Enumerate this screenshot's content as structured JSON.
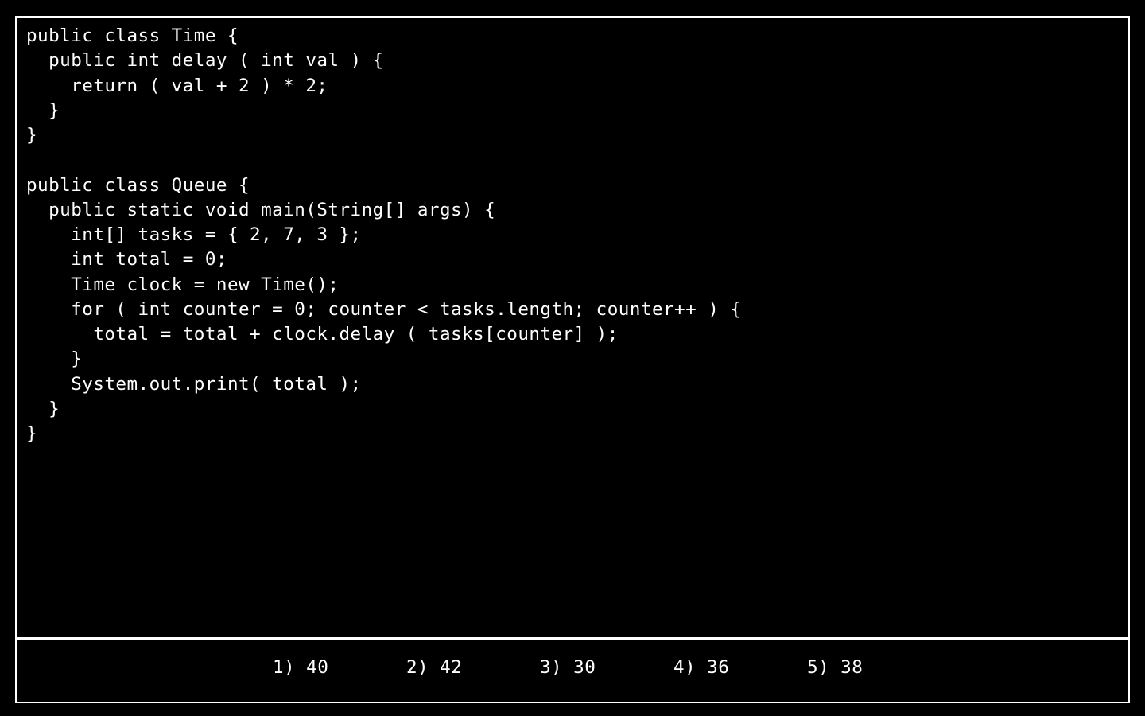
{
  "code": {
    "lines": [
      "public class Time {",
      "  public int delay ( int val ) {",
      "    return ( val + 2 ) * 2;",
      "  }",
      "}",
      "",
      "public class Queue {",
      "  public static void main(String[] args) {",
      "    int[] tasks = { 2, 7, 3 };",
      "    int total = 0;",
      "    Time clock = new Time();",
      "    for ( int counter = 0; counter < tasks.length; counter++ ) {",
      "      total = total + clock.delay ( tasks[counter] );",
      "    }",
      "    System.out.print( total );",
      "  }",
      "}"
    ]
  },
  "answers": [
    {
      "label": "1) 40"
    },
    {
      "label": "2) 42"
    },
    {
      "label": "3) 30"
    },
    {
      "label": "4) 36"
    },
    {
      "label": "5) 38"
    }
  ]
}
